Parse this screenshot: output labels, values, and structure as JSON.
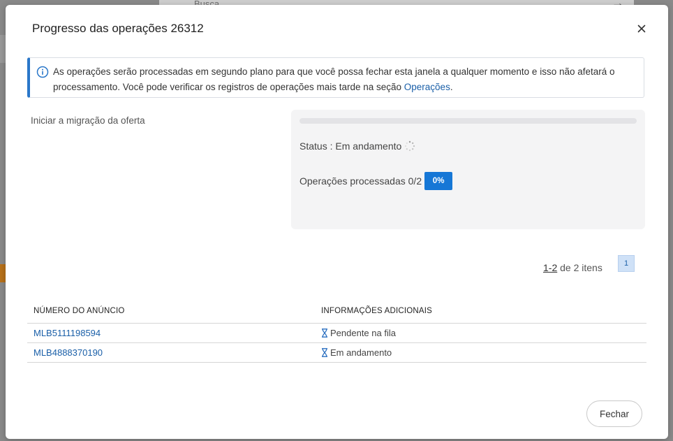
{
  "background": {
    "search_placeholder": "Busca"
  },
  "modal": {
    "title": "Progresso das operações 26312",
    "info": {
      "text": "As operações serão processadas em segundo plano para que você possa fechar esta janela a qualquer momento e isso não afetará o processamento. Você pode verificar os registros de operações mais tarde na seção ",
      "link": "Operações",
      "after_link": "."
    },
    "step_label": "Iniciar a migração da oferta",
    "progress": {
      "fraction": 0,
      "status_label": "Status : Em andamento",
      "ops_label": "Operações processadas 0/2",
      "percent": "0%"
    },
    "pagination": {
      "range": "1-2",
      "suffix": " de 2 itens",
      "current_page": "1"
    },
    "table": {
      "headers": [
        "NÚMERO DO ANÚNCIO",
        "INFORMAÇÕES ADICIONAIS"
      ],
      "rows": [
        {
          "listing": "MLB5111198594",
          "info": "Pendente na fila"
        },
        {
          "listing": "MLB4888370190",
          "info": "Em andamento"
        }
      ]
    },
    "footer": {
      "close_label": "Fechar"
    }
  },
  "colors": {
    "accent": "#1677d6",
    "link": "#1a5fa8",
    "info_border": "#2a77c9"
  }
}
